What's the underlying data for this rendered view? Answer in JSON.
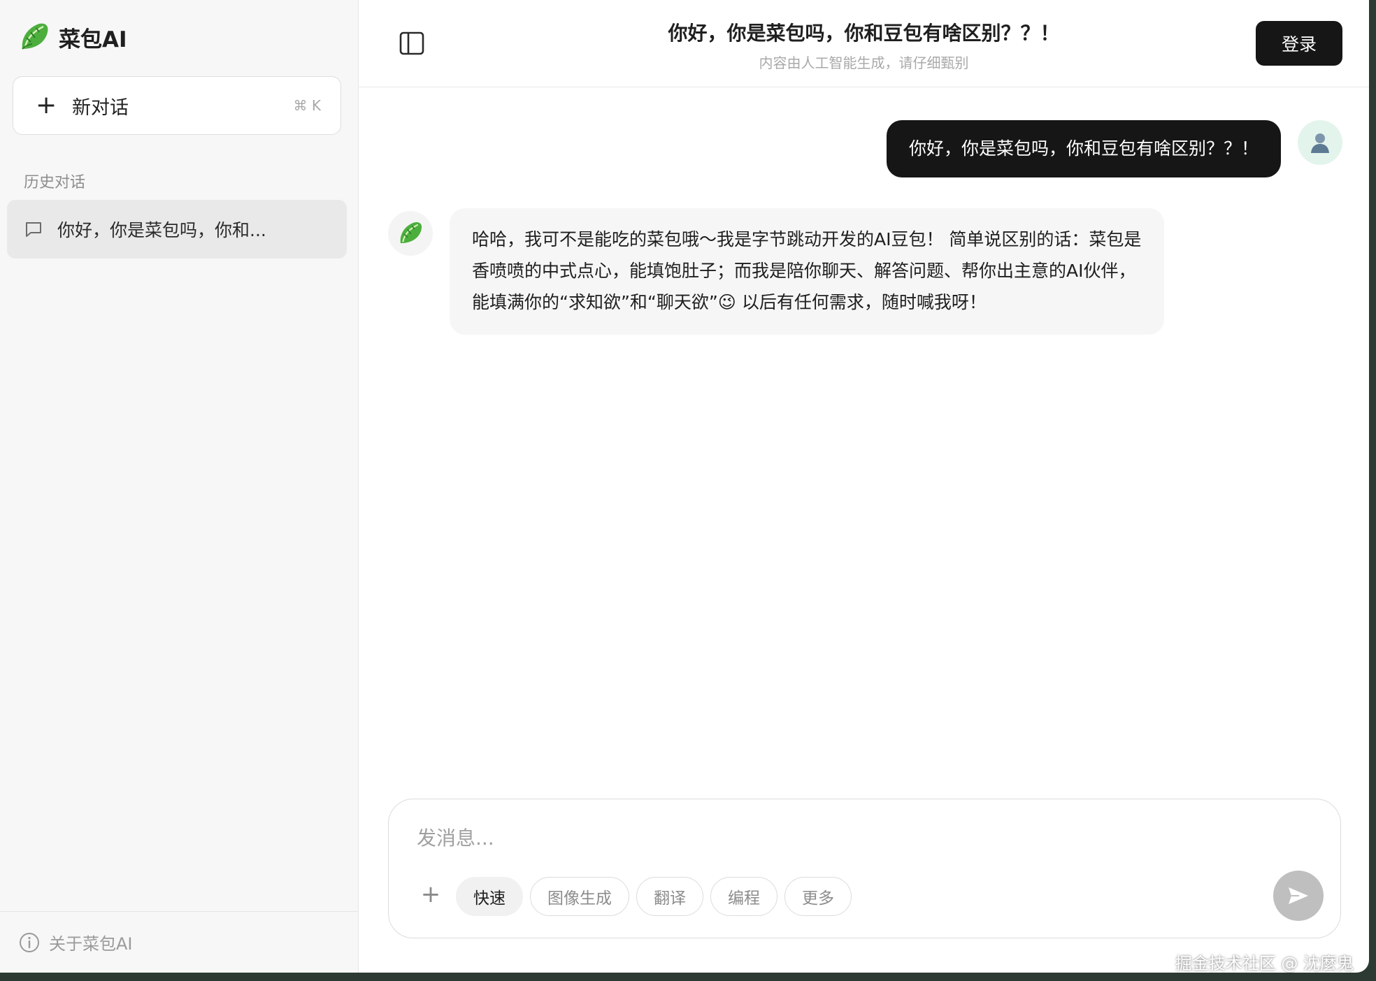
{
  "brand": {
    "name": "菜包AI",
    "logo_icon": "lettuce-icon"
  },
  "sidebar": {
    "new_chat_label": "新对话",
    "new_chat_shortcut": "⌘ K",
    "history_title": "历史对话",
    "history_items": [
      {
        "label": "你好，你是菜包吗，你和..."
      }
    ],
    "footer_label": "关于菜包AI"
  },
  "header": {
    "title": "你好，你是菜包吗，你和豆包有啥区别？？！",
    "subtitle": "内容由人工智能生成，请仔细甄别",
    "login_label": "登录"
  },
  "messages": [
    {
      "role": "user",
      "text": "你好，你是菜包吗，你和豆包有啥区别？？！"
    },
    {
      "role": "assistant",
      "text": "哈哈，我可不是能吃的菜包哦～我是字节跳动开发的AI豆包！ 简单说区别的话：菜包是香喷喷的中式点心，能填饱肚子；而我是陪你聊天、解答问题、帮你出主意的AI伙伴，能填满你的“求知欲”和“聊天欲”😉 以后有任何需求，随时喊我呀！"
    }
  ],
  "composer": {
    "placeholder": "发消息...",
    "chips": [
      {
        "label": "快速",
        "active": true
      },
      {
        "label": "图像生成",
        "active": false
      },
      {
        "label": "翻译",
        "active": false
      },
      {
        "label": "编程",
        "active": false
      },
      {
        "label": "更多",
        "active": false
      }
    ]
  },
  "watermark": "掘金技术社区 @ 沈麼鬼",
  "colors": {
    "accent": "#161616",
    "sidebar_bg": "#f7f7f7",
    "send_disabled": "#bfbfbf"
  }
}
